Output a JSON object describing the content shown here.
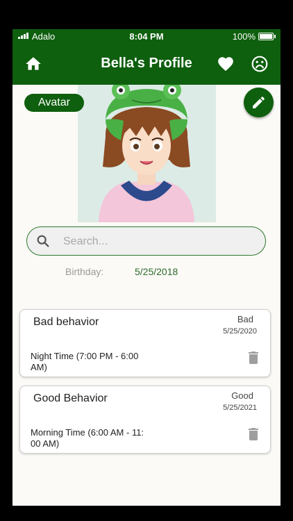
{
  "status_bar": {
    "carrier": "Adalo",
    "time": "8:04 PM",
    "battery": "100%"
  },
  "header": {
    "title": "Bella's Profile",
    "home_icon": "home-icon",
    "favorite_icon": "heart-icon",
    "mood_icon": "sad-face-icon"
  },
  "profile": {
    "avatar_label": "Avatar",
    "edit_icon": "pencil-icon"
  },
  "search": {
    "placeholder": "Search..."
  },
  "birthday": {
    "label": "Birthday:",
    "value": "5/25/2018"
  },
  "behaviors": [
    {
      "title": "Bad behavior",
      "rating": "Bad",
      "date": "5/25/2020",
      "period": "Night Time (7:00 PM - 6:00 AM)"
    },
    {
      "title": "Good Behavior",
      "rating": "Good",
      "date": "5/25/2021",
      "period": "Morning Time (6:00 AM - 11: 00 AM)"
    }
  ],
  "colors": {
    "primary": "#0e5f0e",
    "background": "#fbfaf6",
    "accent_text": "#2e6b2e"
  }
}
